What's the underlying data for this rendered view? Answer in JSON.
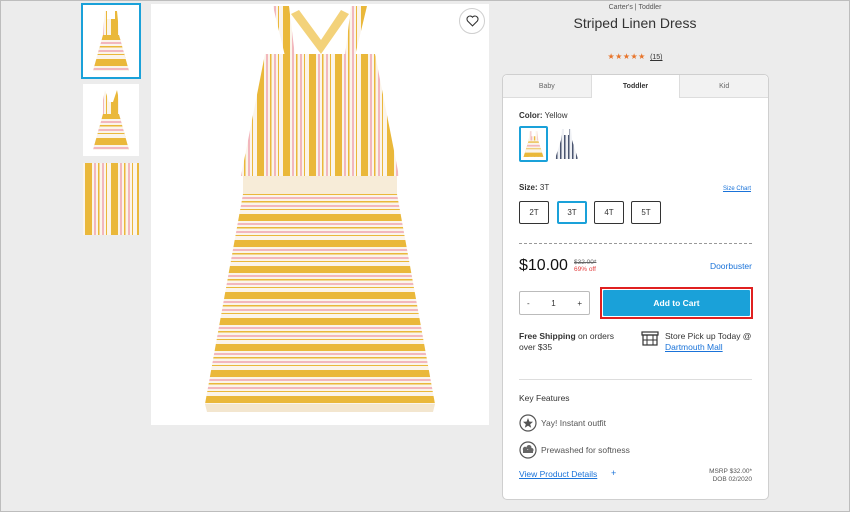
{
  "product": {
    "brand": "Carter's | Toddler",
    "title": "Striped Linen Dress",
    "stars": "★★★★★",
    "review_count": "(15)"
  },
  "tabs": [
    {
      "label": "Baby"
    },
    {
      "label": "Toddler"
    },
    {
      "label": "Kid"
    }
  ],
  "color": {
    "label": "Color:",
    "value": "Yellow"
  },
  "size": {
    "label": "Size:",
    "value": "3T",
    "chart_link": "Size Chart",
    "options": [
      "2T",
      "3T",
      "4T",
      "5T"
    ]
  },
  "pricing": {
    "price": "$10.00",
    "original": "$32.00*",
    "discount": "69% off",
    "badge": "Doorbuster"
  },
  "quantity": {
    "minus": "-",
    "value": "1",
    "plus": "+"
  },
  "cart": {
    "label": "Add to Cart"
  },
  "shipping": {
    "bold": "Free Shipping",
    "rest": " on orders over $35"
  },
  "store": {
    "text": "Store Pick up Today @",
    "link": "Dartmouth Mall"
  },
  "features": {
    "title": "Key Features",
    "items": [
      "Yay! Instant outfit",
      "Prewashed for softness"
    ]
  },
  "details": {
    "link": "View Product Details",
    "plus": "+",
    "msrp": "MSRP $32.00*",
    "dob": "DOB 02/2020"
  },
  "colors": {
    "accent": "#1aa1d9",
    "highlight": "#e02020",
    "link": "#1a73d9",
    "stars": "#e8742a",
    "sale": "#e23b3b"
  }
}
